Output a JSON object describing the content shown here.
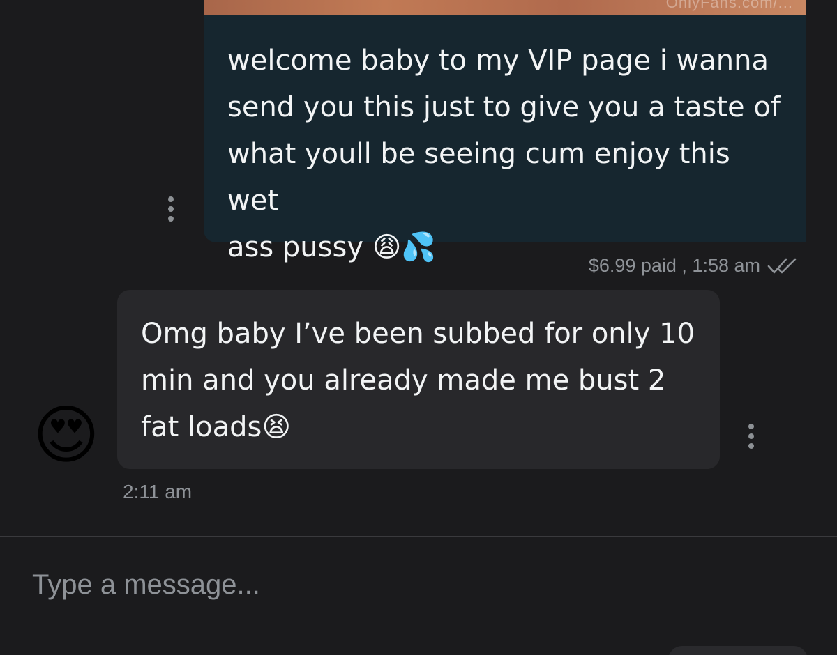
{
  "media": {
    "watermark": "OnlyFans.com/..."
  },
  "sent_message": {
    "text": "welcome baby to my VIP page i wanna\nsend you this just to give you a taste of\nwhat youll be seeing cum enjoy this wet\nass pussy 😩💦",
    "meta": "$6.99 paid , 1:58 am"
  },
  "received_message": {
    "text": "Omg baby I’ve been subbed for only 10\nmin and you already made me bust 2\nfat loads😫",
    "time": "2:11 am",
    "avatar": "😍"
  },
  "composer": {
    "placeholder": "Type a message..."
  },
  "icons": {
    "more": "more-vertical-icon",
    "read_receipt": "double-check-icon"
  },
  "colors": {
    "background": "#1b1b1d",
    "sent_bubble": "#16262f",
    "received_bubble": "#28282b",
    "meta_text": "#8e9297"
  }
}
